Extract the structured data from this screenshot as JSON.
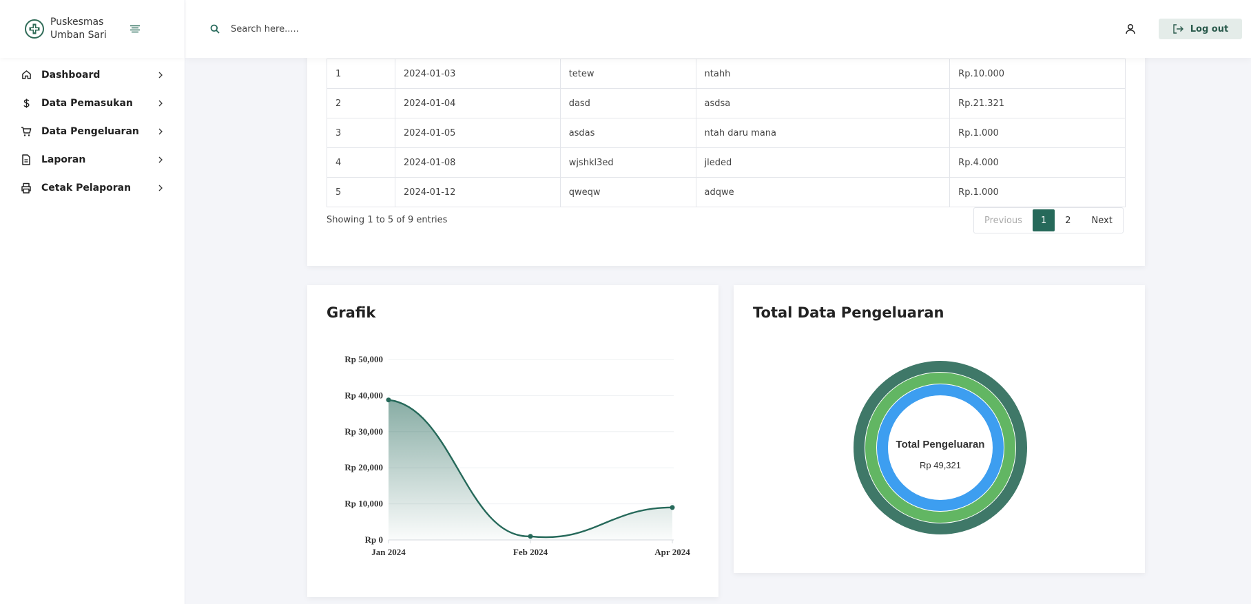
{
  "brand": {
    "name": "Puskesmas Umban Sari"
  },
  "sidebar": {
    "items": [
      {
        "label": "Dashboard",
        "icon": "home-icon"
      },
      {
        "label": "Data Pemasukan",
        "icon": "dollar-icon"
      },
      {
        "label": "Data Pengeluaran",
        "icon": "cart-icon"
      },
      {
        "label": "Laporan",
        "icon": "document-icon"
      },
      {
        "label": "Cetak Pelaporan",
        "icon": "printer-icon"
      }
    ]
  },
  "header": {
    "search_placeholder": "Search here.....",
    "logout_label": "Log out"
  },
  "table": {
    "rows": [
      [
        "1",
        "2024-01-03",
        "tetew",
        "ntahh",
        "Rp.10.000"
      ],
      [
        "2",
        "2024-01-04",
        "dasd",
        "asdsa",
        "Rp.21.321"
      ],
      [
        "3",
        "2024-01-05",
        "asdas",
        "ntah daru mana",
        "Rp.1.000"
      ],
      [
        "4",
        "2024-01-08",
        "wjshkl3ed",
        "jleded",
        "Rp.4.000"
      ],
      [
        "5",
        "2024-01-12",
        "qweqw",
        "adqwe",
        "Rp.1.000"
      ]
    ],
    "info": "Showing 1 to 5 of 9 entries",
    "pagination": {
      "previous": "Previous",
      "pages": [
        "1",
        "2"
      ],
      "active": "1",
      "next": "Next"
    }
  },
  "grafik": {
    "title": "Grafik"
  },
  "donut": {
    "title": "Total Data Pengeluaran",
    "center_label": "Total Pengeluaran",
    "center_value": "Rp 49,321"
  },
  "colors": {
    "primary": "#26695a",
    "ring_outer": "#3f7868",
    "ring_middle": "#62b663",
    "ring_inner": "#3d9ef0"
  },
  "chart_data": [
    {
      "type": "area",
      "title": "Grafik",
      "categories": [
        "Jan 2024",
        "Feb 2024",
        "Apr 2024"
      ],
      "values": [
        38800,
        1000,
        9000
      ],
      "ylim": [
        0,
        50000
      ],
      "yticks": [
        "Rp 0",
        "Rp 10,000",
        "Rp 20,000",
        "Rp 30,000",
        "Rp 40,000",
        "Rp 50,000"
      ],
      "grid": true,
      "color": "#26695a"
    },
    {
      "type": "pie",
      "title": "Total Data Pengeluaran",
      "series": [
        {
          "value": 1,
          "color": "#3f7868"
        },
        {
          "value": 1,
          "color": "#62b663"
        },
        {
          "value": 1,
          "color": "#3d9ef0"
        }
      ],
      "center_label": "Total Pengeluaran",
      "center_value": "Rp 49,321"
    }
  ]
}
